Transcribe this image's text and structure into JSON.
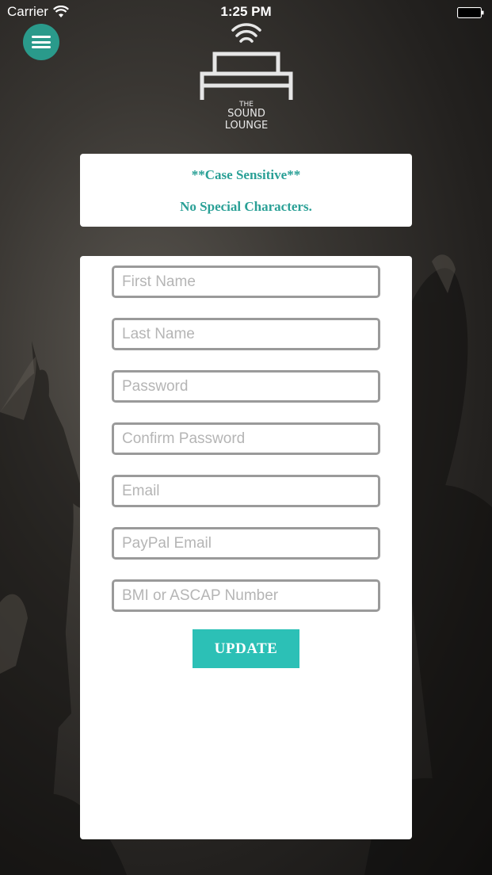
{
  "status_bar": {
    "carrier": "Carrier",
    "time": "1:25 PM"
  },
  "logo": {
    "line1": "THE",
    "line2": "SOUND",
    "line3": "LOUNGE"
  },
  "info": {
    "line1": "**Case Sensitive**",
    "line2": "No Special Characters."
  },
  "form": {
    "fields": [
      {
        "placeholder": "First Name",
        "value": ""
      },
      {
        "placeholder": "Last Name",
        "value": ""
      },
      {
        "placeholder": "Password",
        "value": ""
      },
      {
        "placeholder": "Confirm Password",
        "value": ""
      },
      {
        "placeholder": "Email",
        "value": ""
      },
      {
        "placeholder": "PayPal Email",
        "value": ""
      },
      {
        "placeholder": "BMI or ASCAP Number",
        "value": ""
      }
    ],
    "submit_label": "UPDATE"
  },
  "colors": {
    "accent": "#2cc0b6",
    "menu_button": "#2a9a8b",
    "info_text": "#2aa096"
  },
  "icons": {
    "menu": "hamburger-icon",
    "wifi": "wifi-icon",
    "battery": "battery-icon"
  }
}
